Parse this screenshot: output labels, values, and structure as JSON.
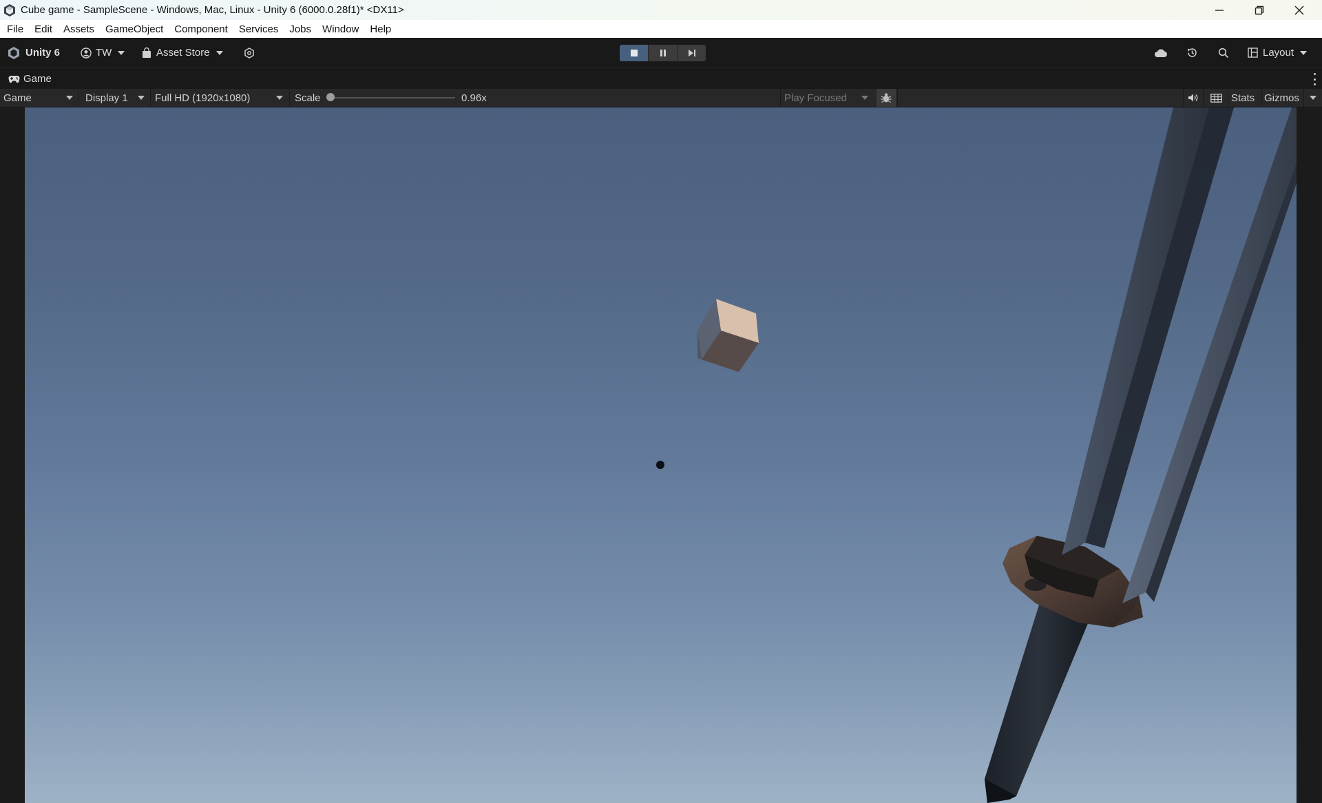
{
  "window": {
    "title": "Cube game - SampleScene - Windows, Mac, Linux - Unity 6 (6000.0.28f1)* <DX11>",
    "controls": [
      "minimize-icon",
      "restore-icon",
      "close-icon"
    ]
  },
  "menubar": {
    "items": [
      "File",
      "Edit",
      "Assets",
      "GameObject",
      "Component",
      "Services",
      "Jobs",
      "Window",
      "Help"
    ]
  },
  "toolbar": {
    "product": "Unity 6",
    "account": "TW",
    "asset_store": "Asset Store",
    "play_controls": [
      "stop-icon",
      "pause-icon",
      "step-icon"
    ],
    "layout": "Layout",
    "right_icons": [
      "cloud-icon",
      "history-icon",
      "search-icon",
      "layout-icon"
    ]
  },
  "tab": {
    "label": "Game"
  },
  "game_toolbar": {
    "view_mode": "Game",
    "display": "Display 1",
    "resolution": "Full HD (1920x1080)",
    "scale_label": "Scale",
    "scale_value": "0.96x",
    "scale_level": 0.0,
    "play_mode": "Play Focused",
    "stats": "Stats",
    "gizmos": "Gizmos",
    "icons": [
      "bug-icon",
      "audio-icon",
      "grid-icon"
    ]
  },
  "colors": {
    "accent_play": "#46607e",
    "sky_top": "#4b5f7e",
    "sky_bottom": "#9eb2c6"
  }
}
